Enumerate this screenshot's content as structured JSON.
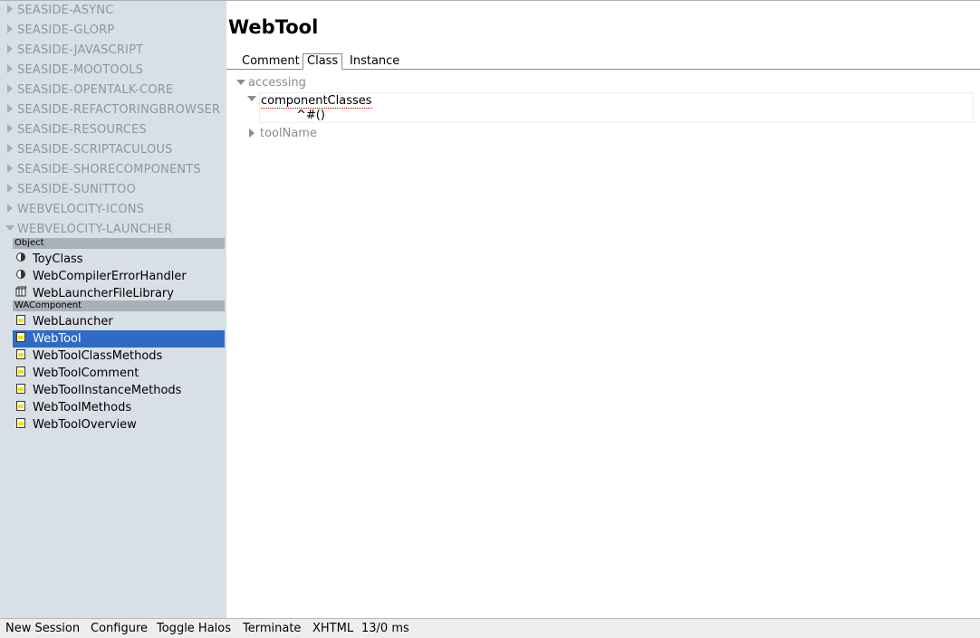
{
  "sidebar": {
    "packages": [
      "SEASIDE-ASYNC",
      "SEASIDE-GLORP",
      "SEASIDE-JAVASCRIPT",
      "SEASIDE-MOOTOOLS",
      "SEASIDE-OPENTALK-CORE",
      "SEASIDE-REFACTORINGBROWSER",
      "SEASIDE-RESOURCES",
      "SEASIDE-SCRIPTACULOUS",
      "SEASIDE-SHORECOMPONENTS",
      "SEASIDE-SUNITTOO",
      "WEBVELOCITY-ICONS"
    ],
    "expanded_package": "WEBVELOCITY-LAUNCHER",
    "groups": [
      {
        "name": "Object",
        "classes": [
          {
            "label": "ToyClass",
            "icon": "half-circle-icon"
          },
          {
            "label": "WebCompilerErrorHandler",
            "icon": "half-circle-icon"
          },
          {
            "label": "WebLauncherFileLibrary",
            "icon": "library-icon"
          }
        ]
      },
      {
        "name": "WAComponent",
        "classes": [
          {
            "label": "WebLauncher",
            "icon": "component-icon"
          },
          {
            "label": "WebTool",
            "icon": "component-icon",
            "selected": true
          },
          {
            "label": "WebToolClassMethods",
            "icon": "component-icon"
          },
          {
            "label": "WebToolComment",
            "icon": "component-icon"
          },
          {
            "label": "WebToolInstanceMethods",
            "icon": "component-icon"
          },
          {
            "label": "WebToolMethods",
            "icon": "component-icon"
          },
          {
            "label": "WebToolOverview",
            "icon": "component-icon"
          }
        ]
      }
    ]
  },
  "main": {
    "title": "WebTool",
    "tabs": [
      "Comment",
      "Class",
      "Instance"
    ],
    "active_tab": "Class",
    "protocol": "accessing",
    "method_open": "componentClasses",
    "method_source": "^#()",
    "method_closed": "toolName"
  },
  "statusbar": {
    "items": [
      "New Session",
      "Configure",
      "Toggle Halos",
      "Terminate",
      "XHTML"
    ],
    "timing": "13/0 ms"
  },
  "colors": {
    "sidebar_bg": "#d8dfe6",
    "selection": "#316ac5",
    "group_header": "#a8b0b8",
    "package_text": "#8f969c"
  }
}
